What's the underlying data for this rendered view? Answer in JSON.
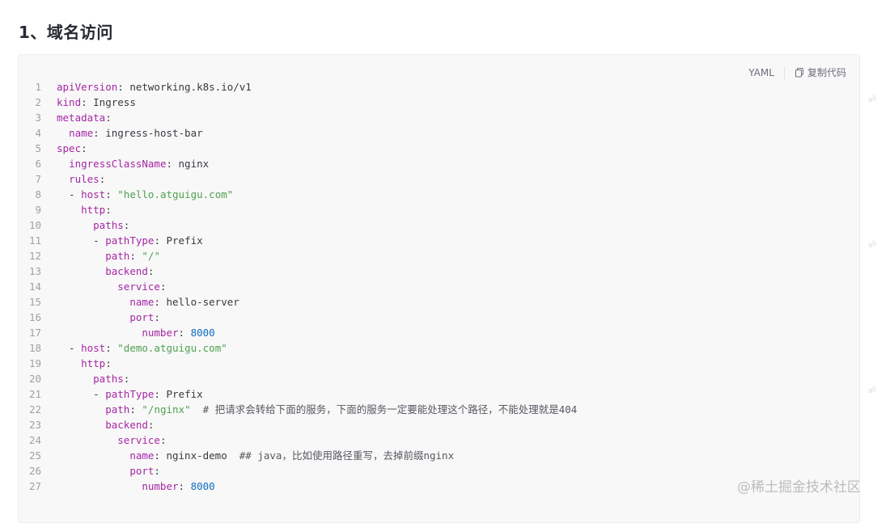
{
  "heading": "1、域名访问",
  "toolbar": {
    "language": "YAML",
    "copy_label": "复制代码"
  },
  "watermark": "@稀土掘金技术社区",
  "side_marks": [
    "aii",
    "aii",
    "aii"
  ],
  "code_lines": [
    {
      "num": "1",
      "tokens": [
        {
          "t": "apiVersion",
          "c": "k"
        },
        {
          "t": ": networking.k8s.io/v1",
          "c": "d"
        }
      ]
    },
    {
      "num": "2",
      "tokens": [
        {
          "t": "kind",
          "c": "k"
        },
        {
          "t": ": Ingress",
          "c": "d"
        }
      ]
    },
    {
      "num": "3",
      "tokens": [
        {
          "t": "metadata",
          "c": "k"
        },
        {
          "t": ":",
          "c": "d"
        }
      ]
    },
    {
      "num": "4",
      "tokens": [
        {
          "t": "  ",
          "c": "d"
        },
        {
          "t": "name",
          "c": "k"
        },
        {
          "t": ": ingress-host-bar",
          "c": "d"
        }
      ]
    },
    {
      "num": "5",
      "tokens": [
        {
          "t": "spec",
          "c": "k"
        },
        {
          "t": ":",
          "c": "d"
        }
      ]
    },
    {
      "num": "6",
      "tokens": [
        {
          "t": "  ",
          "c": "d"
        },
        {
          "t": "ingressClassName",
          "c": "k"
        },
        {
          "t": ": nginx",
          "c": "d"
        }
      ]
    },
    {
      "num": "7",
      "tokens": [
        {
          "t": "  ",
          "c": "d"
        },
        {
          "t": "rules",
          "c": "k"
        },
        {
          "t": ":",
          "c": "d"
        }
      ]
    },
    {
      "num": "8",
      "tokens": [
        {
          "t": "  - ",
          "c": "d"
        },
        {
          "t": "host",
          "c": "k"
        },
        {
          "t": ": ",
          "c": "d"
        },
        {
          "t": "\"hello.atguigu.com\"",
          "c": "s"
        }
      ]
    },
    {
      "num": "9",
      "tokens": [
        {
          "t": "    ",
          "c": "d"
        },
        {
          "t": "http",
          "c": "k"
        },
        {
          "t": ":",
          "c": "d"
        }
      ]
    },
    {
      "num": "10",
      "tokens": [
        {
          "t": "      ",
          "c": "d"
        },
        {
          "t": "paths",
          "c": "k"
        },
        {
          "t": ":",
          "c": "d"
        }
      ]
    },
    {
      "num": "11",
      "tokens": [
        {
          "t": "      - ",
          "c": "d"
        },
        {
          "t": "pathType",
          "c": "k"
        },
        {
          "t": ": Prefix",
          "c": "d"
        }
      ]
    },
    {
      "num": "12",
      "tokens": [
        {
          "t": "        ",
          "c": "d"
        },
        {
          "t": "path",
          "c": "k"
        },
        {
          "t": ": ",
          "c": "d"
        },
        {
          "t": "\"/\"",
          "c": "s"
        }
      ]
    },
    {
      "num": "13",
      "tokens": [
        {
          "t": "        ",
          "c": "d"
        },
        {
          "t": "backend",
          "c": "k"
        },
        {
          "t": ":",
          "c": "d"
        }
      ]
    },
    {
      "num": "14",
      "tokens": [
        {
          "t": "          ",
          "c": "d"
        },
        {
          "t": "service",
          "c": "k"
        },
        {
          "t": ":",
          "c": "d"
        }
      ]
    },
    {
      "num": "15",
      "tokens": [
        {
          "t": "            ",
          "c": "d"
        },
        {
          "t": "name",
          "c": "k"
        },
        {
          "t": ": hello-server",
          "c": "d"
        }
      ]
    },
    {
      "num": "16",
      "tokens": [
        {
          "t": "            ",
          "c": "d"
        },
        {
          "t": "port",
          "c": "k"
        },
        {
          "t": ":",
          "c": "d"
        }
      ]
    },
    {
      "num": "17",
      "tokens": [
        {
          "t": "              ",
          "c": "d"
        },
        {
          "t": "number",
          "c": "k"
        },
        {
          "t": ": ",
          "c": "d"
        },
        {
          "t": "8000",
          "c": "n"
        }
      ]
    },
    {
      "num": "18",
      "tokens": [
        {
          "t": "  - ",
          "c": "d"
        },
        {
          "t": "host",
          "c": "k"
        },
        {
          "t": ": ",
          "c": "d"
        },
        {
          "t": "\"demo.atguigu.com\"",
          "c": "s"
        }
      ]
    },
    {
      "num": "19",
      "tokens": [
        {
          "t": "    ",
          "c": "d"
        },
        {
          "t": "http",
          "c": "k"
        },
        {
          "t": ":",
          "c": "d"
        }
      ]
    },
    {
      "num": "20",
      "tokens": [
        {
          "t": "      ",
          "c": "d"
        },
        {
          "t": "paths",
          "c": "k"
        },
        {
          "t": ":",
          "c": "d"
        }
      ]
    },
    {
      "num": "21",
      "tokens": [
        {
          "t": "      - ",
          "c": "d"
        },
        {
          "t": "pathType",
          "c": "k"
        },
        {
          "t": ": Prefix",
          "c": "d"
        }
      ]
    },
    {
      "num": "22",
      "tokens": [
        {
          "t": "        ",
          "c": "d"
        },
        {
          "t": "path",
          "c": "k"
        },
        {
          "t": ": ",
          "c": "d"
        },
        {
          "t": "\"/nginx\"",
          "c": "s"
        },
        {
          "t": "  # 把请求会转给下面的服务，下面的服务一定要能处理这个路径，不能处理就是404",
          "c": "c"
        }
      ]
    },
    {
      "num": "23",
      "tokens": [
        {
          "t": "        ",
          "c": "d"
        },
        {
          "t": "backend",
          "c": "k"
        },
        {
          "t": ":",
          "c": "d"
        }
      ]
    },
    {
      "num": "24",
      "tokens": [
        {
          "t": "          ",
          "c": "d"
        },
        {
          "t": "service",
          "c": "k"
        },
        {
          "t": ":",
          "c": "d"
        }
      ]
    },
    {
      "num": "25",
      "tokens": [
        {
          "t": "            ",
          "c": "d"
        },
        {
          "t": "name",
          "c": "k"
        },
        {
          "t": ": nginx-demo  ",
          "c": "d"
        },
        {
          "t": "## java，比如使用路径重写，去掉前缀nginx",
          "c": "c"
        }
      ]
    },
    {
      "num": "26",
      "tokens": [
        {
          "t": "            ",
          "c": "d"
        },
        {
          "t": "port",
          "c": "k"
        },
        {
          "t": ":",
          "c": "d"
        }
      ]
    },
    {
      "num": "27",
      "tokens": [
        {
          "t": "              ",
          "c": "d"
        },
        {
          "t": "number",
          "c": "k"
        },
        {
          "t": ": ",
          "c": "d"
        },
        {
          "t": "8000",
          "c": "n"
        }
      ]
    }
  ]
}
